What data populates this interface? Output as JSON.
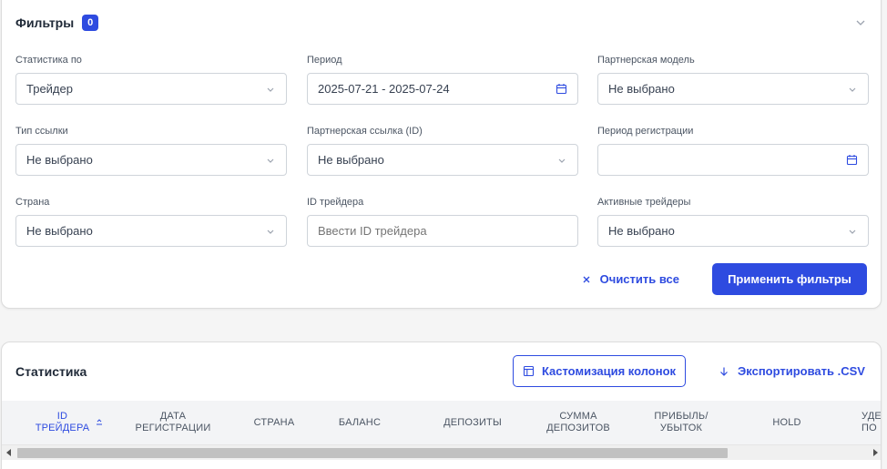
{
  "filters": {
    "title": "Фильтры",
    "badge_count": "0",
    "fields": {
      "stat_by": {
        "label": "Статистика по",
        "value": "Трейдер"
      },
      "period": {
        "label": "Период",
        "value": "2025-07-21 - 2025-07-24"
      },
      "partner_model": {
        "label": "Партнерская модель",
        "value": "Не выбрано"
      },
      "link_type": {
        "label": "Тип ссылки",
        "value": "Не выбрано"
      },
      "partner_link": {
        "label": "Партнерская ссылка (ID)",
        "value": "Не выбрано"
      },
      "reg_period": {
        "label": "Период регистрации",
        "value": ""
      },
      "country": {
        "label": "Страна",
        "value": "Не выбрано"
      },
      "trader_id": {
        "label": "ID трейдера",
        "placeholder": "Ввести ID трейдера"
      },
      "active_traders": {
        "label": "Активные трейдеры",
        "value": "Не выбрано"
      }
    },
    "clear_label": "Очистить все",
    "apply_label": "Применить фильтры"
  },
  "stats": {
    "title": "Статистика",
    "customize_label": "Кастомизация колонок",
    "export_label": "Экспортировать .CSV",
    "columns": [
      "ID\nТРЕЙДЕРА",
      "ДАТА\nРЕГИСТРАЦИИ",
      "СТРАНА",
      "БАЛАНС",
      "ДЕПОЗИТЫ",
      "СУММА\nДЕПОЗИТОВ",
      "ПРИБЫЛЬ/\nУБЫТОК",
      "HOLD",
      "УДЕ\nПО"
    ],
    "sorted_column": "ID ТРЕЙДЕРА"
  },
  "colors": {
    "accent": "#2e4be0",
    "background": "#f5f5f5",
    "card": "#ffffff",
    "table_header": "#f3f4f6"
  },
  "icons": {
    "collapse": "chevron-up-icon",
    "select": "chevron-down-icon",
    "date": "calendar-icon",
    "clear": "close-icon",
    "customize": "columns-icon",
    "export": "download-arrow-icon",
    "sort": "sort-ascending-icon"
  }
}
